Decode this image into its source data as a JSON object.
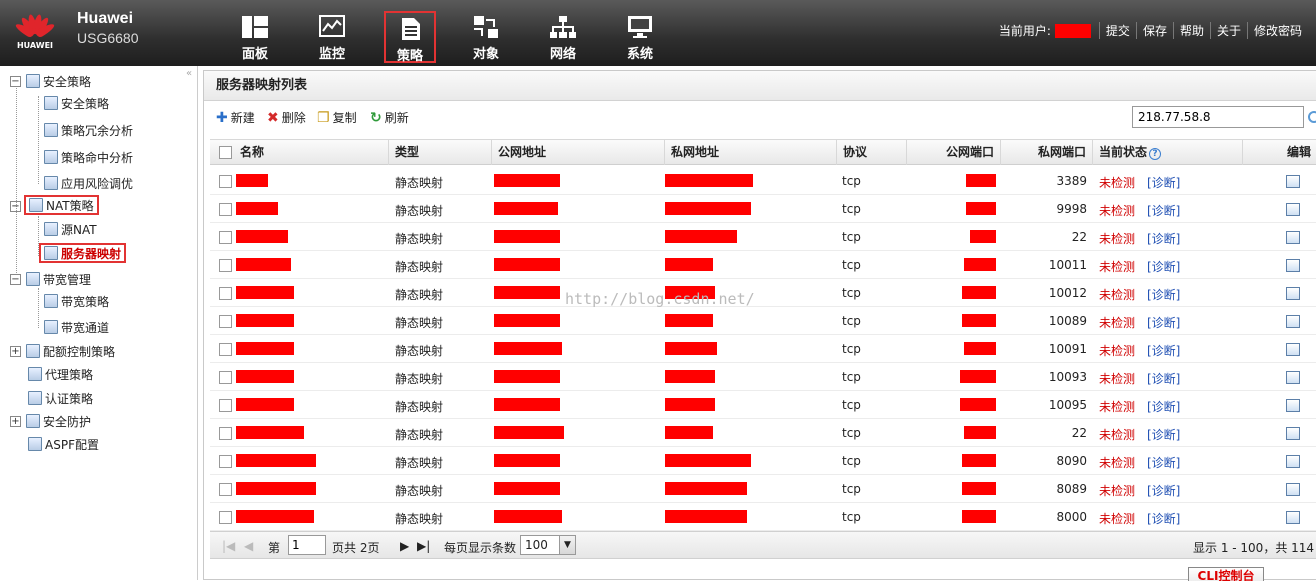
{
  "header": {
    "brand": "Huawei",
    "model": "USG6680",
    "logo_text": "HUAWEI",
    "nav": [
      {
        "label": "面板",
        "icon": "dashboard-icon"
      },
      {
        "label": "监控",
        "icon": "monitor-chart-icon"
      },
      {
        "label": "策略",
        "icon": "document-icon",
        "selected": true
      },
      {
        "label": "对象",
        "icon": "object-icon"
      },
      {
        "label": "网络",
        "icon": "network-icon"
      },
      {
        "label": "系统",
        "icon": "computer-icon"
      }
    ],
    "current_user_label": "当前用户:",
    "links": [
      "提交",
      "保存",
      "帮助",
      "关于",
      "修改密码"
    ]
  },
  "sidebar": {
    "items": [
      {
        "label": "安全策略"
      },
      {
        "label": "安全策略"
      },
      {
        "label": "策略冗余分析"
      },
      {
        "label": "策略命中分析"
      },
      {
        "label": "应用风险调优"
      },
      {
        "label": "NAT策略"
      },
      {
        "label": "源NAT"
      },
      {
        "label": "服务器映射"
      },
      {
        "label": "带宽管理"
      },
      {
        "label": "带宽策略"
      },
      {
        "label": "带宽通道"
      },
      {
        "label": "配额控制策略"
      },
      {
        "label": "代理策略"
      },
      {
        "label": "认证策略"
      },
      {
        "label": "安全防护"
      },
      {
        "label": "ASPF配置"
      }
    ]
  },
  "main": {
    "title": "服务器映射列表",
    "toolbar": {
      "new": "新建",
      "delete": "删除",
      "copy": "复制",
      "refresh": "刷新"
    },
    "search_value": "218.77.58.8",
    "columns": [
      "名称",
      "类型",
      "公网地址",
      "私网地址",
      "协议",
      "公网端口",
      "私网端口",
      "当前状态",
      "编辑"
    ],
    "rows": [
      {
        "type": "静态映射",
        "protocol": "tcp",
        "private_port": "3389",
        "status": "未检测",
        "diag": "[诊断]"
      },
      {
        "type": "静态映射",
        "protocol": "tcp",
        "private_port": "9998",
        "status": "未检测",
        "diag": "[诊断]"
      },
      {
        "type": "静态映射",
        "protocol": "tcp",
        "private_port": "22",
        "status": "未检测",
        "diag": "[诊断]"
      },
      {
        "type": "静态映射",
        "protocol": "tcp",
        "private_port": "10011",
        "status": "未检测",
        "diag": "[诊断]"
      },
      {
        "type": "静态映射",
        "protocol": "tcp",
        "private_port": "10012",
        "status": "未检测",
        "diag": "[诊断]"
      },
      {
        "type": "静态映射",
        "protocol": "tcp",
        "private_port": "10089",
        "status": "未检测",
        "diag": "[诊断]"
      },
      {
        "type": "静态映射",
        "protocol": "tcp",
        "private_port": "10091",
        "status": "未检测",
        "diag": "[诊断]"
      },
      {
        "type": "静态映射",
        "protocol": "tcp",
        "private_port": "10093",
        "status": "未检测",
        "diag": "[诊断]"
      },
      {
        "type": "静态映射",
        "protocol": "tcp",
        "private_port": "10095",
        "status": "未检测",
        "diag": "[诊断]"
      },
      {
        "type": "静态映射",
        "protocol": "tcp",
        "private_port": "22",
        "status": "未检测",
        "diag": "[诊断]"
      },
      {
        "type": "静态映射",
        "protocol": "tcp",
        "private_port": "8090",
        "status": "未检测",
        "diag": "[诊断]"
      },
      {
        "type": "静态映射",
        "protocol": "tcp",
        "private_port": "8089",
        "status": "未检测",
        "diag": "[诊断]"
      },
      {
        "type": "静态映射",
        "protocol": "tcp",
        "private_port": "8000",
        "status": "未检测",
        "diag": "[诊断]"
      }
    ],
    "pager": {
      "page_prefix": "第",
      "page_value": "1",
      "page_total": "页共 2页",
      "per_page_label": "每页显示条数",
      "per_page_value": "100",
      "summary": "显示 1 - 100，共 114"
    }
  },
  "console_button": "CLI控制台",
  "watermark": "http://blog.csdn.net/",
  "colors": {
    "redaction": "#ff0000",
    "status": "#d00000",
    "link": "#1f4fb3",
    "highlight_box": "#e23333"
  }
}
